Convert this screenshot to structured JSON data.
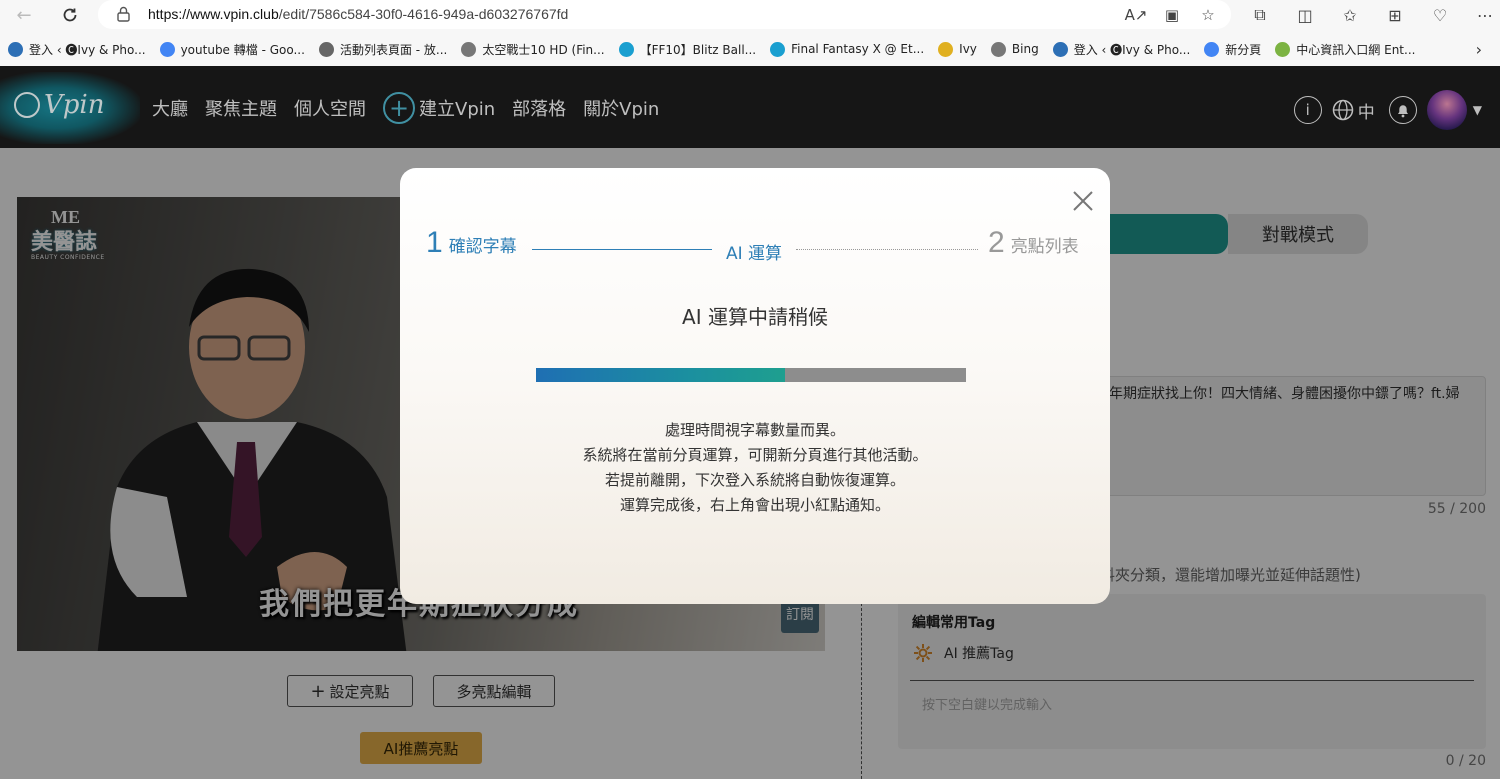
{
  "browser": {
    "url_host": "https://www.vpin.club",
    "url_path": "/edit/7586c584-30f0-4616-949a-d603276767fd",
    "bookmarks": [
      {
        "label": "登入 ‹ 🅒Ivy & Pho...",
        "color": "#2d6fb5"
      },
      {
        "label": "youtube 轉檔 - Goo...",
        "color": "#4285f4"
      },
      {
        "label": "活動列表頁面 - 放...",
        "color": "#666666"
      },
      {
        "label": "太空戰士10 HD (Fin...",
        "color": "#777777"
      },
      {
        "label": "【FF10】Blitz Ball...",
        "color": "#1a9fd0"
      },
      {
        "label": "Final Fantasy X @ Et...",
        "color": "#1a9fd0"
      },
      {
        "label": "Ivy",
        "color": "#e0b020"
      },
      {
        "label": "Bing",
        "color": "#777777"
      },
      {
        "label": "登入 ‹ 🅒Ivy & Pho...",
        "color": "#2d6fb5"
      },
      {
        "label": "新分頁",
        "color": "#4285f4"
      },
      {
        "label": "中心資訊入口網 Ent...",
        "color": "#7cb342"
      }
    ]
  },
  "header": {
    "logo": "Vpin",
    "nav": [
      "大廳",
      "聚焦主題",
      "個人空間"
    ],
    "create_label": "建立Vpin",
    "nav_after": [
      "部落格",
      "關於Vpin"
    ],
    "lang": "中"
  },
  "video": {
    "logo_me": "ME",
    "logo_zh": "美醫誌",
    "logo_en": "BEAUTY CONFIDENCE",
    "subtitle": "我們把更年期症狀分成",
    "badge": "訂閱"
  },
  "buttons": {
    "set_highlight": "設定亮點",
    "multi_edit": "多亮點編輯",
    "ai_recommend": "AI推薦亮點"
  },
  "right_panel": {
    "mode_inactive": "對戰模式",
    "title_text": "年期症狀找上你！四大情緒、身體困擾你中鏢了嗎？ft.婦",
    "title_counter": "55 / 200",
    "tag_hint": "料夾分類，還能增加曝光並延伸話題性)",
    "tag_common": "編輯常用Tag",
    "ai_tag": "AI 推薦Tag",
    "tag_placeholder": "按下空白鍵以完成輸入",
    "tag_counter": "0 / 20"
  },
  "modal": {
    "step1_num": "1",
    "step1_label": "確認字幕",
    "step_mid": "AI 運算",
    "step2_num": "2",
    "step2_label": "亮點列表",
    "title": "AI 運算中請稍候",
    "progress_fraction": 0.58,
    "desc": [
      "處理時間視字幕數量而異。",
      "系統將在當前分頁運算，可開新分頁進行其他活動。",
      "若提前離開，下次登入系統將自動恢復運算。",
      "運算完成後，右上角會出現小紅點通知。"
    ]
  }
}
